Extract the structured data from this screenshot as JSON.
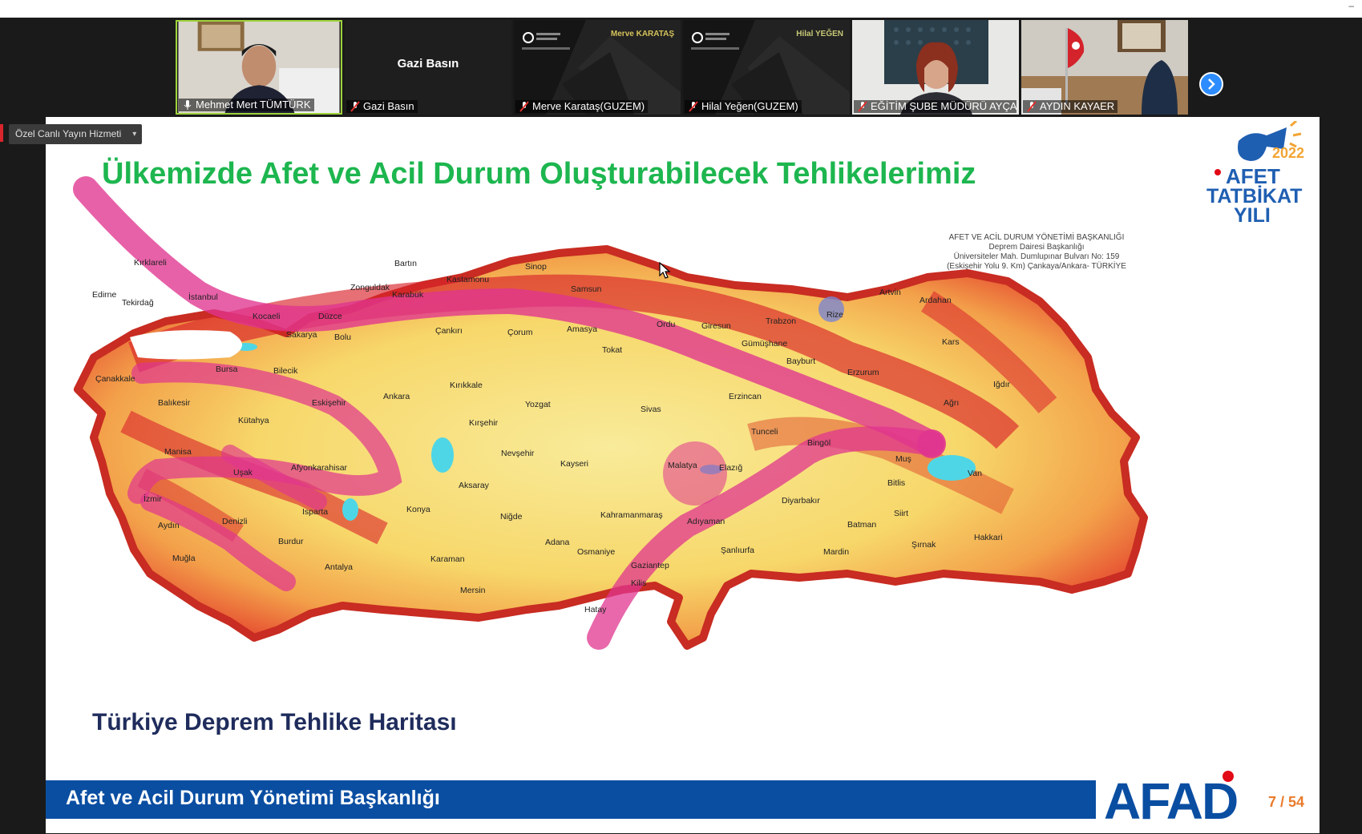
{
  "window": {
    "minimize_glyph": "–"
  },
  "participants": [
    {
      "name": "Mehmet Mert TÜMTÜRK",
      "mic": "on",
      "video": "person-office",
      "active": true
    },
    {
      "name": "Gazi Basın",
      "mic": "muted",
      "video": "none",
      "display_name": "Gazi Basın"
    },
    {
      "name": "Merve Karataş(GUZEM)",
      "mic": "muted",
      "video": "virtual-background",
      "corner_label": "Merve KARATAŞ"
    },
    {
      "name": "Hilal Yeğen(GUZEM)",
      "mic": "muted",
      "video": "virtual-background",
      "corner_label": "Hilal YEĞEN"
    },
    {
      "name": "EĞİTİM ŞUBE MÜDÜRÜ AYÇA ...",
      "mic": "muted",
      "video": "person-office"
    },
    {
      "name": "AYDIN KAYAER",
      "mic": "muted",
      "video": "office-flag"
    }
  ],
  "share": {
    "live_button": "Özel Canlı Yayın Hizmeti"
  },
  "slide": {
    "title": "Ülkemizde Afet ve Acil Durum Oluşturabilecek Tehlikelerimiz",
    "logo": {
      "year": "2022",
      "line1": "AFET",
      "line2": "TATBİKAT",
      "line3": "YILI"
    },
    "address": [
      "AFET VE ACİL DURUM YÖNETİMİ BAŞKANLIĞI",
      "Deprem Dairesi Başkanlığı",
      "Üniversiteler Mah. Dumlupınar Bulvarı No: 159",
      "(Eskişehir Yolu 9. Km) Çankaya/Ankara- TÜRKİYE"
    ],
    "map_caption": "Türkiye Deprem Tehlike Haritası",
    "footer": "Afet ve Acil Durum Yönetimi Başkanlığı",
    "footer_logo": "AFAD",
    "page": "7 / 54",
    "colors": {
      "title": "#1db64f",
      "footer": "#0a4ea2",
      "page": "#e97b2c",
      "hazard_high": "#d81e2a",
      "hazard_low": "#f7e37a",
      "fault": "#e0358f"
    },
    "cities": [
      "Kırklareli",
      "Edirne",
      "Tekirdağ",
      "İstanbul",
      "Kocaeli",
      "Sakarya",
      "Düzce",
      "Bolu",
      "Zonguldak",
      "Bartın",
      "Karabük",
      "Kastamonu",
      "Sinop",
      "Samsun",
      "Çankırı",
      "Çorum",
      "Amasya",
      "Tokat",
      "Ordu",
      "Giresun",
      "Trabzon",
      "Rize",
      "Artvin",
      "Ardahan",
      "Kars",
      "Gümüşhane",
      "Bayburt",
      "Erzurum",
      "Erzincan",
      "Iğdır",
      "Ağrı",
      "Çanakkale",
      "Balıkesir",
      "Bursa",
      "Bilecik",
      "Eskişehir",
      "Ankara",
      "Kırıkkale",
      "Yozgat",
      "Sivas",
      "Kırşehir",
      "Kütahya",
      "Nevşehir",
      "Kayseri",
      "Malatya",
      "Elazığ",
      "Tunceli",
      "Bingöl",
      "Muş",
      "Van",
      "Bitlis",
      "Siirt",
      "Hakkari",
      "Şırnak",
      "Batman",
      "Mardin",
      "Diyarbakır",
      "Şanlıurfa",
      "Adıyaman",
      "Kahramanmaraş",
      "Gaziantep",
      "Kilis",
      "Hatay",
      "Osmaniye",
      "Adana",
      "Mersin",
      "Karaman",
      "Niğde",
      "Aksaray",
      "Konya",
      "Antalya",
      "Isparta",
      "Burdur",
      "Afyonkarahisar",
      "Uşak",
      "Manisa",
      "İzmir",
      "Aydın",
      "Denizli",
      "Muğla"
    ]
  }
}
